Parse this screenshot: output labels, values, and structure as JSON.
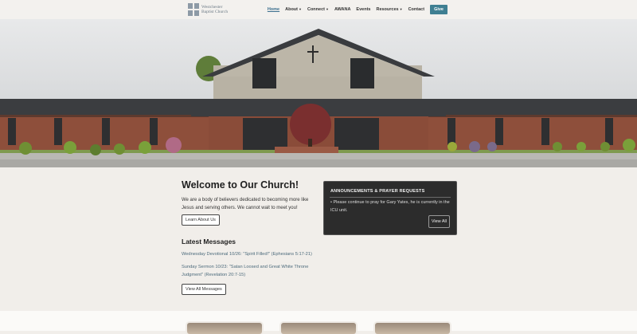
{
  "header": {
    "logo_line1": "Westchester",
    "logo_line2": "Baptist Church",
    "nav": [
      {
        "label": "Home",
        "dropdown": false
      },
      {
        "label": "About",
        "dropdown": true
      },
      {
        "label": "Connect",
        "dropdown": true
      },
      {
        "label": "AWANA",
        "dropdown": false
      },
      {
        "label": "Events",
        "dropdown": false
      },
      {
        "label": "Resources",
        "dropdown": true
      },
      {
        "label": "Contact",
        "dropdown": false
      }
    ],
    "give_label": "Give"
  },
  "welcome": {
    "title": "Welcome to Our Church!",
    "text": "We are a body of believers dedicated to becoming more like Jesus and serving others. We cannot wait to meet you!",
    "button": "Learn About Us"
  },
  "announcements": {
    "title": "ANNOUNCEMENTS & PRAYER REQUESTS",
    "item": "• Please continue to pray for Gary Yates, he is currently in the ICU unit.",
    "button": "View All"
  },
  "messages": {
    "title": "Latest Messages",
    "items": [
      "Wednesday Devotional 10/26: \"Spirit Filled!\" (Ephesians 5:17-21)",
      "Sunday Sermon 10/23: \"Satan Loosed and Great White Throne Judgment\" (Revelation 20:7-15)"
    ],
    "button": "View All Messages"
  },
  "colors": {
    "accent": "#3f7f92",
    "link": "#4d6b7c",
    "announcement_bg": "#2c2c2c",
    "page_bg": "#f1eeea"
  }
}
